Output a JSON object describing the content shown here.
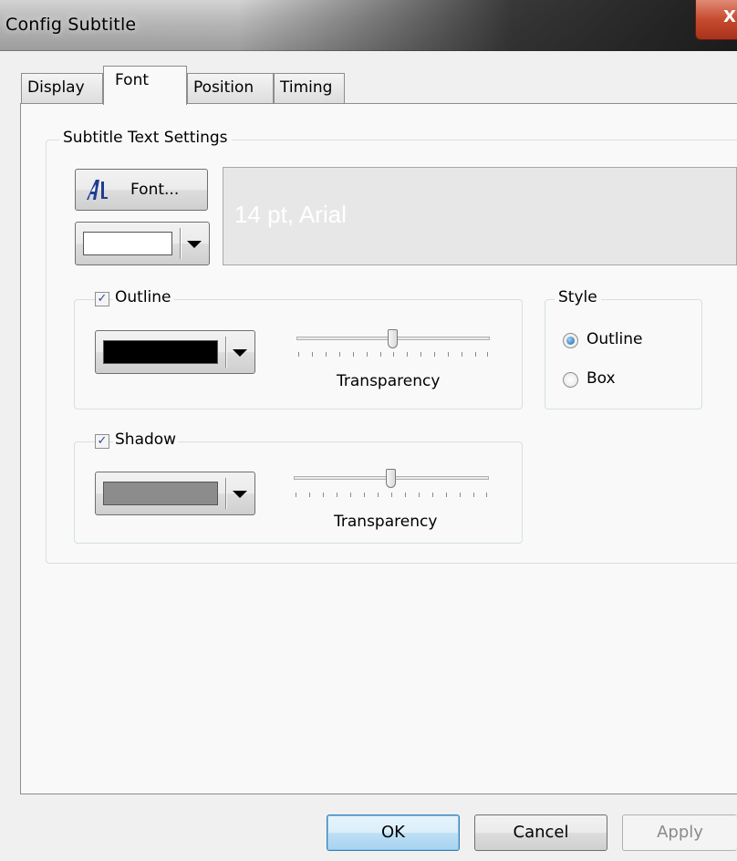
{
  "window": {
    "title": "Config Subtitle",
    "close_label": "X"
  },
  "tabs": [
    {
      "label": "Display",
      "active": false
    },
    {
      "label": "Font",
      "active": true
    },
    {
      "label": "Position",
      "active": false
    },
    {
      "label": "Timing",
      "active": false
    }
  ],
  "subtitle_text_settings": {
    "group_label": "Subtitle Text Settings",
    "font_button_label": "Font...",
    "font_color": "#ffffff",
    "preview_text": "14 pt, Arial",
    "preview_background": "#e7e7e7"
  },
  "outline": {
    "label": "Outline",
    "checked": true,
    "color": "#000000",
    "transparency_label": "Transparency",
    "transparency_fraction": 0.5
  },
  "shadow": {
    "label": "Shadow",
    "checked": true,
    "color": "#8c8c8c",
    "transparency_label": "Transparency",
    "transparency_fraction": 0.5
  },
  "style": {
    "group_label": "Style",
    "options": [
      {
        "label": "Outline",
        "selected": true
      },
      {
        "label": "Box",
        "selected": false
      }
    ]
  },
  "buttons": {
    "ok": "OK",
    "cancel": "Cancel",
    "apply": "Apply"
  },
  "icons": {
    "font_icon": "font-a-icon",
    "close_icon": "close-icon"
  }
}
